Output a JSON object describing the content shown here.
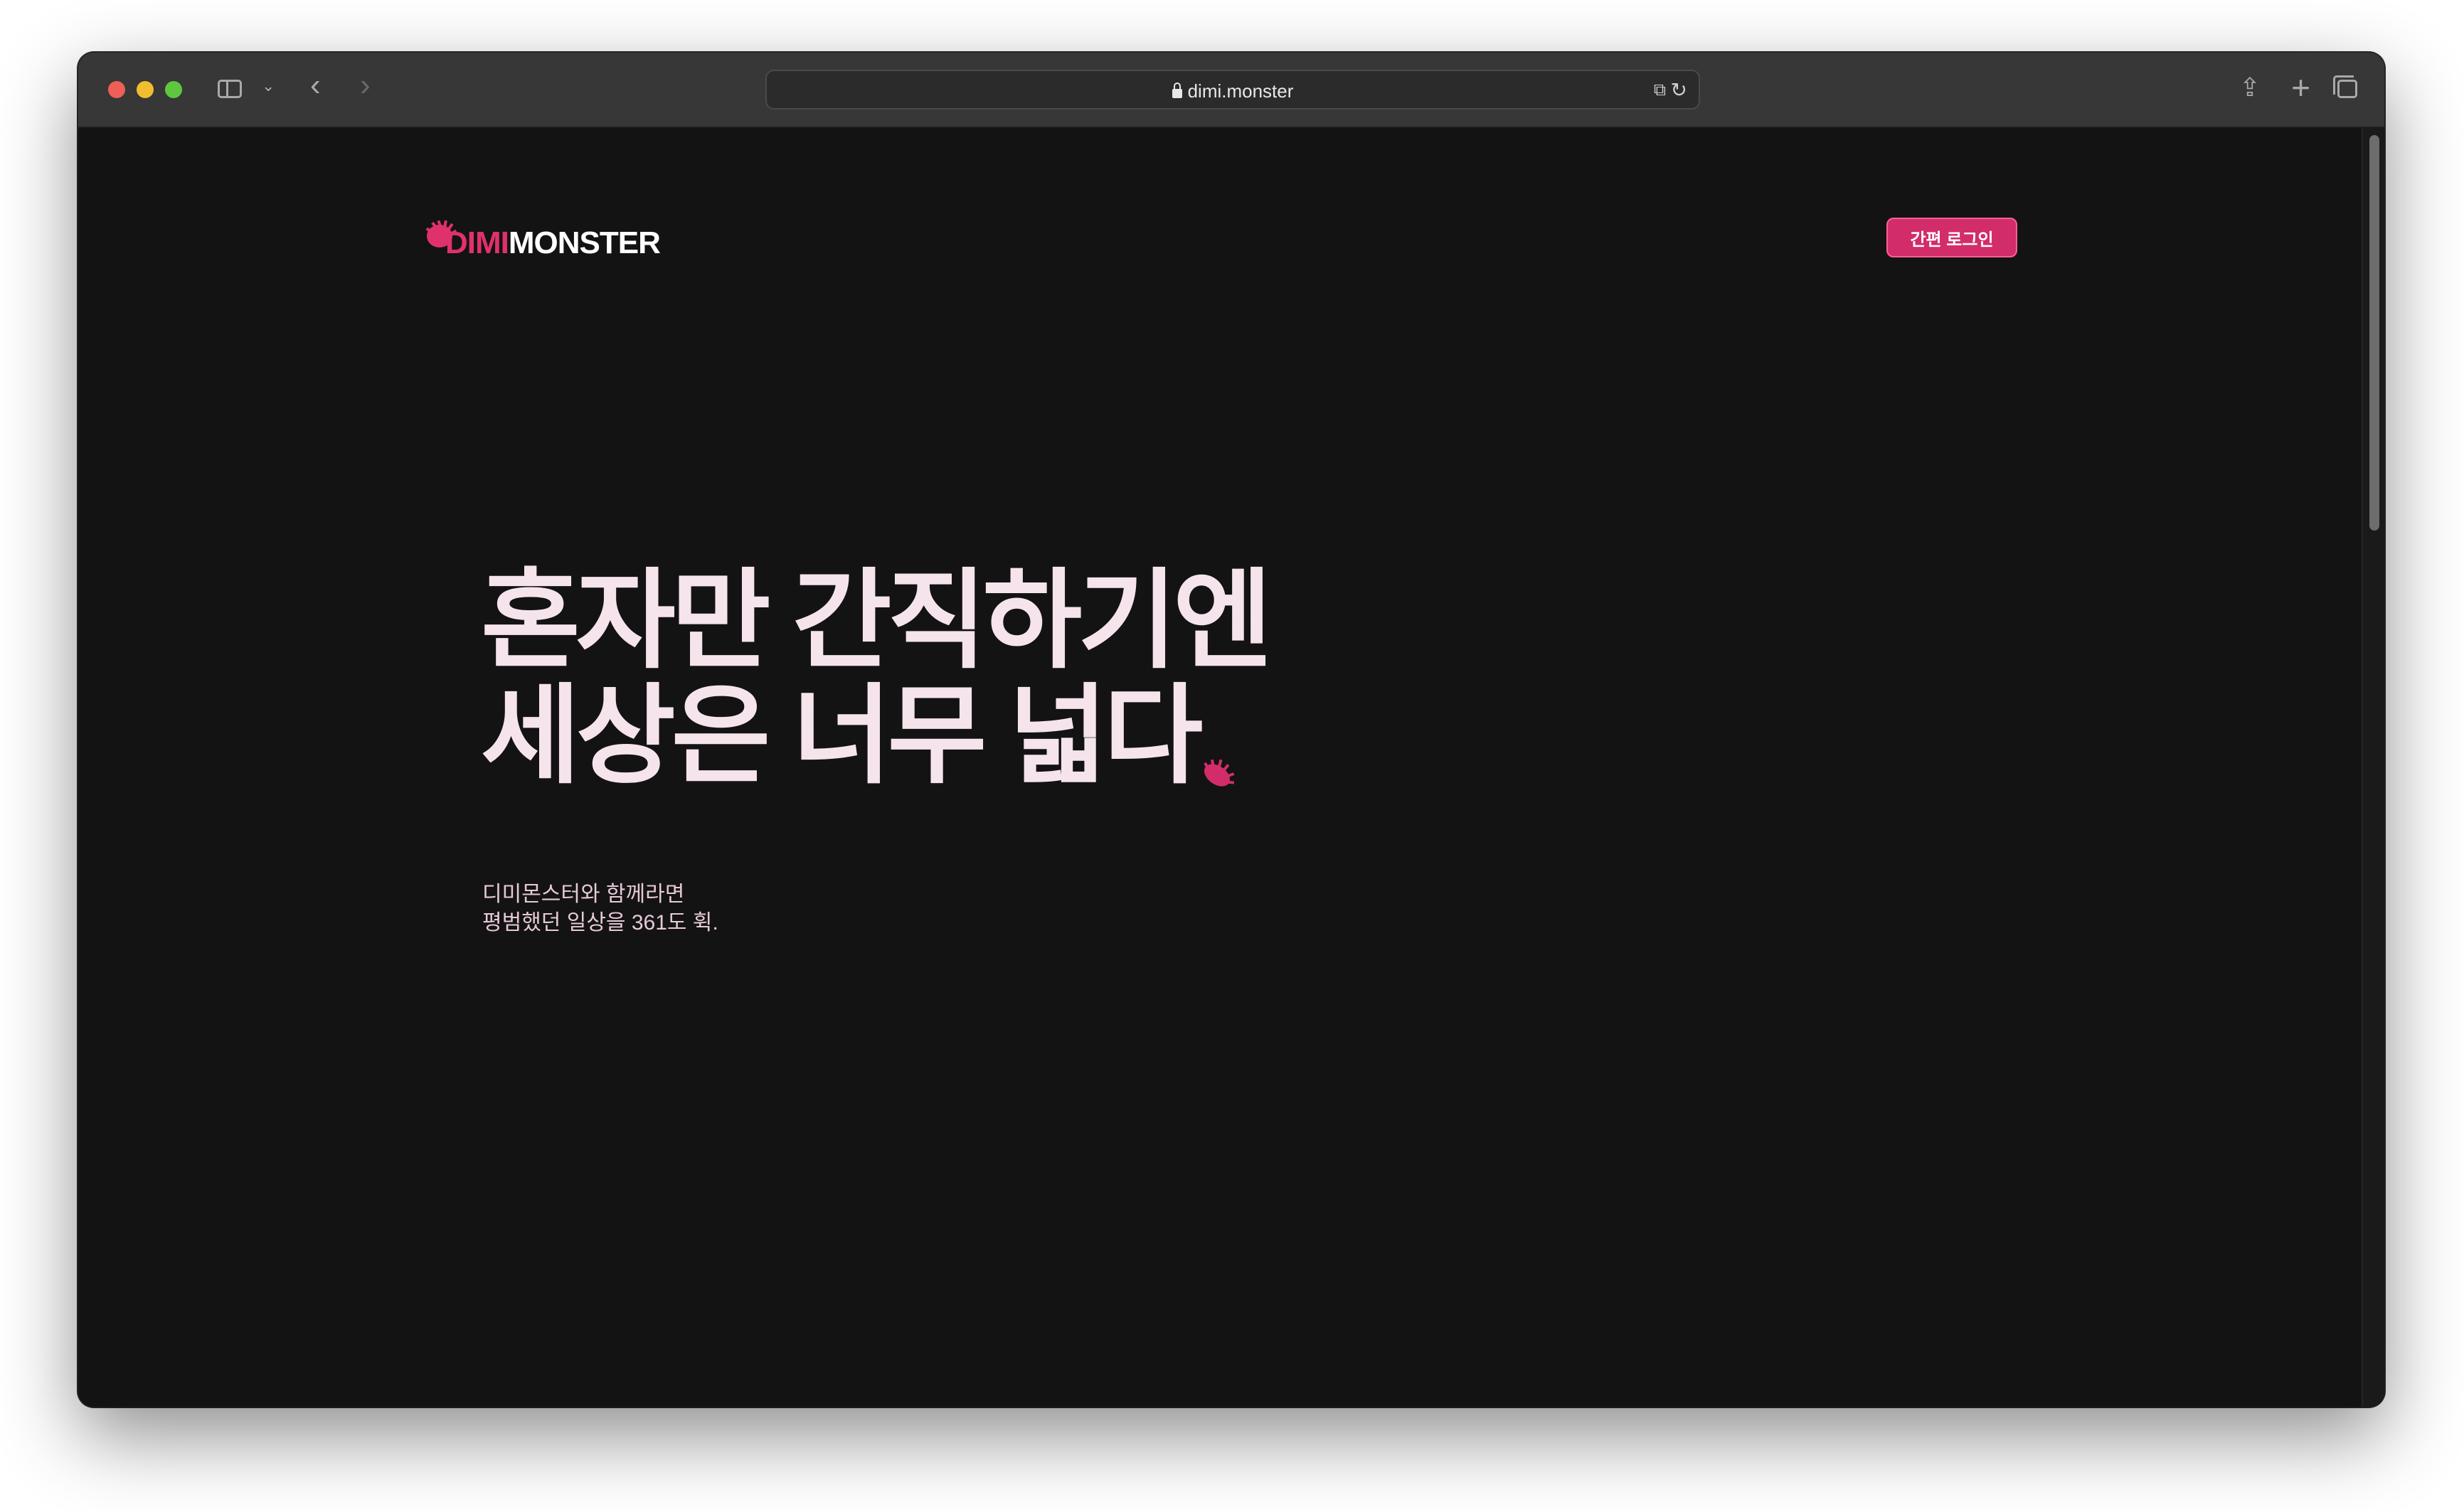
{
  "browser": {
    "url": "dimi.monster"
  },
  "page": {
    "logo": {
      "part1": "DIMI",
      "part2": "MONSTER"
    },
    "login_button": "간편 로그인",
    "headline": {
      "line1": "혼자만 간직하기엔",
      "line2_prefix": "세상은 ",
      "line2_highlight": "너무 넓다"
    },
    "subtext": {
      "line1": "디미몬스터와 함께라면",
      "line2": "평범했던 일상을 361도 휙."
    }
  },
  "colors": {
    "accent": "#d22d6a",
    "background": "#131313",
    "headline": "#f6e4ec"
  }
}
